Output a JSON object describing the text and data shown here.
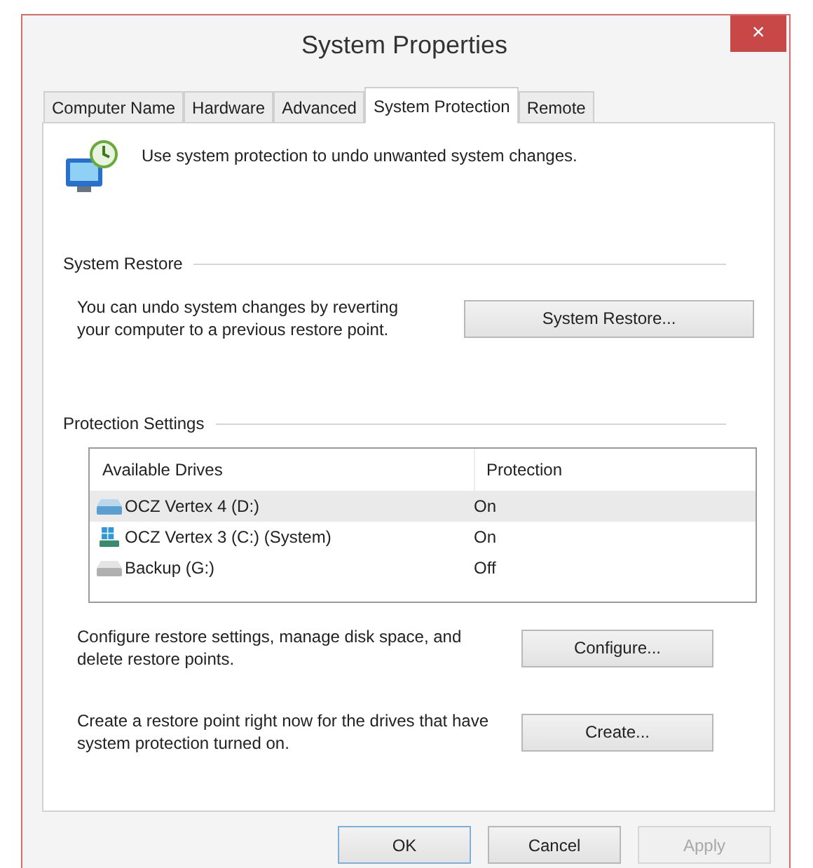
{
  "window": {
    "title": "System Properties",
    "close": "×"
  },
  "tabs": [
    {
      "label": "Computer Name",
      "selected": false
    },
    {
      "label": "Hardware",
      "selected": false
    },
    {
      "label": "Advanced",
      "selected": false
    },
    {
      "label": "System Protection",
      "selected": true
    },
    {
      "label": "Remote",
      "selected": false
    }
  ],
  "intro": "Use system protection to undo unwanted system changes.",
  "system_restore": {
    "heading": "System Restore",
    "text": "You can undo system changes by reverting your computer to a previous restore point.",
    "button": "System Restore..."
  },
  "protection_settings": {
    "heading": "Protection Settings",
    "table": {
      "columns": [
        "Available Drives",
        "Protection"
      ],
      "rows": [
        {
          "drive": "OCZ Vertex 4 (D:)",
          "protection": "On",
          "kind": "ssd",
          "selected": true
        },
        {
          "drive": "OCZ Vertex 3 (C:) (System)",
          "protection": "On",
          "kind": "system",
          "selected": false
        },
        {
          "drive": "Backup (G:)",
          "protection": "Off",
          "kind": "removable",
          "selected": false
        }
      ]
    },
    "actions": [
      {
        "text": "Configure restore settings, manage disk space, and delete restore points.",
        "button": "Configure..."
      },
      {
        "text": "Create a restore point right now for the drives that have system protection turned on.",
        "button": "Create..."
      }
    ]
  },
  "buttons": [
    {
      "label": "OK",
      "disabled": false,
      "default": true
    },
    {
      "label": "Cancel",
      "disabled": false,
      "default": false
    },
    {
      "label": "Apply",
      "disabled": true,
      "default": false
    }
  ]
}
